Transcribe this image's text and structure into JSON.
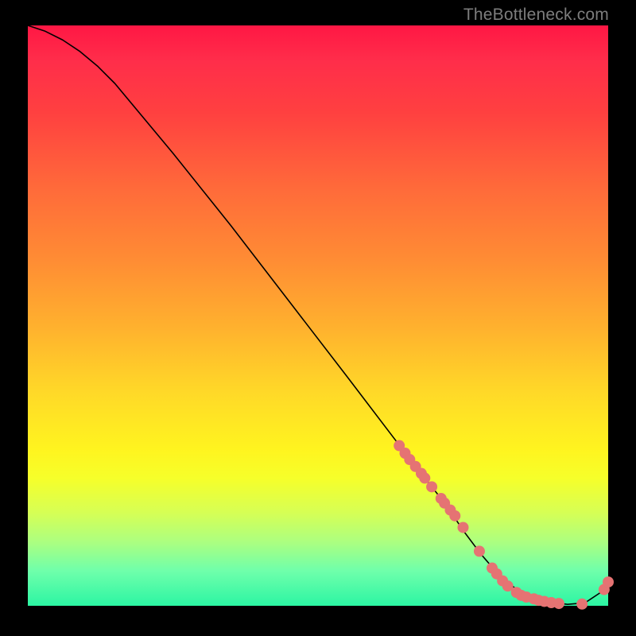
{
  "watermark": "TheBottleneck.com",
  "chart_data": {
    "type": "line",
    "title": "",
    "xlabel": "",
    "ylabel": "",
    "xlim": [
      0,
      100
    ],
    "ylim": [
      0,
      100
    ],
    "grid": false,
    "series": [
      {
        "name": "curve",
        "x": [
          0,
          3,
          6,
          9,
          12,
          15,
          25,
          35,
          45,
          55,
          63,
          68,
          72,
          75,
          78,
          81,
          84,
          87,
          90,
          93,
          96,
          99,
          100
        ],
        "y": [
          100,
          99,
          97.5,
          95.5,
          93,
          90,
          78,
          65.5,
          52.5,
          39.5,
          29,
          22.5,
          17.5,
          13,
          9,
          5.5,
          3,
          1.4,
          0.6,
          0.25,
          0.5,
          2.5,
          4
        ],
        "color": "#000000",
        "linewidth": 1.6
      }
    ],
    "markers": [
      {
        "name": "cluster-dots",
        "color": "#e57373",
        "radius": 7,
        "points": [
          {
            "x": 64,
            "y": 27.6
          },
          {
            "x": 65,
            "y": 26.3
          },
          {
            "x": 65.8,
            "y": 25.2
          },
          {
            "x": 66.8,
            "y": 24.0
          },
          {
            "x": 67.8,
            "y": 22.8
          },
          {
            "x": 68.4,
            "y": 22.0
          },
          {
            "x": 69.6,
            "y": 20.5
          },
          {
            "x": 71.2,
            "y": 18.5
          },
          {
            "x": 71.8,
            "y": 17.7
          },
          {
            "x": 72.8,
            "y": 16.5
          },
          {
            "x": 73.6,
            "y": 15.5
          },
          {
            "x": 75.0,
            "y": 13.5
          },
          {
            "x": 77.8,
            "y": 9.4
          },
          {
            "x": 80.0,
            "y": 6.5
          },
          {
            "x": 80.8,
            "y": 5.5
          },
          {
            "x": 81.8,
            "y": 4.3
          },
          {
            "x": 82.7,
            "y": 3.4
          },
          {
            "x": 84.2,
            "y": 2.3
          },
          {
            "x": 85.0,
            "y": 1.8
          },
          {
            "x": 85.9,
            "y": 1.5
          },
          {
            "x": 87.2,
            "y": 1.2
          },
          {
            "x": 88.0,
            "y": 0.95
          },
          {
            "x": 89.0,
            "y": 0.75
          },
          {
            "x": 90.2,
            "y": 0.55
          },
          {
            "x": 91.5,
            "y": 0.4
          },
          {
            "x": 95.5,
            "y": 0.3
          },
          {
            "x": 99.3,
            "y": 2.8
          },
          {
            "x": 100.0,
            "y": 4.1
          }
        ]
      }
    ]
  }
}
